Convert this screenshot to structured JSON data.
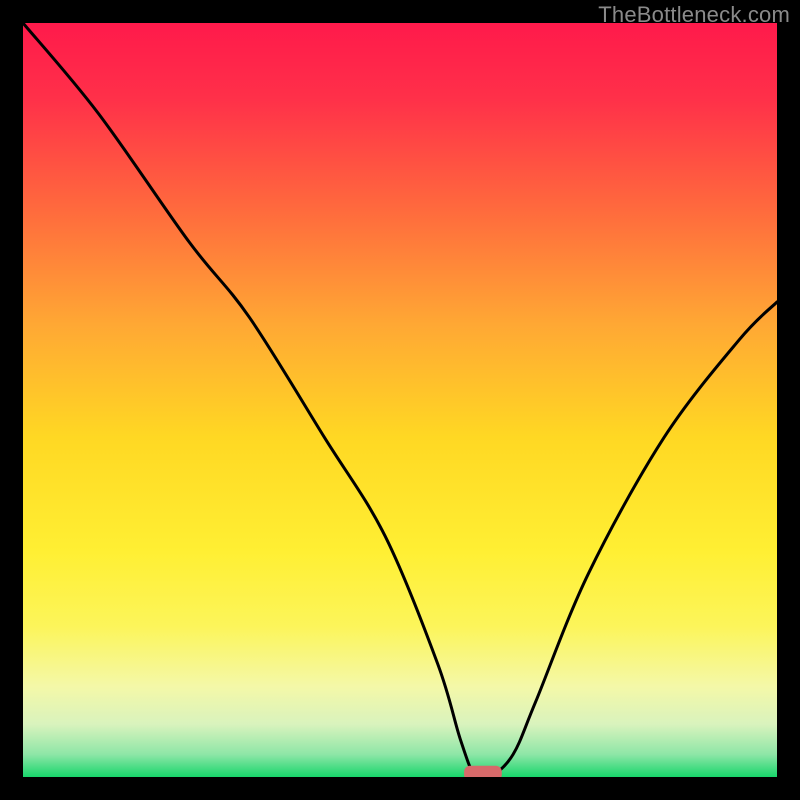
{
  "watermark": "TheBottleneck.com",
  "chart_data": {
    "type": "line",
    "title": "",
    "xlabel": "",
    "ylabel": "",
    "xlim": [
      0,
      100
    ],
    "ylim": [
      0,
      100
    ],
    "grid": false,
    "legend": false,
    "gradient_stops": [
      {
        "offset": 0.0,
        "color": "#ff1a4b"
      },
      {
        "offset": 0.1,
        "color": "#ff3049"
      },
      {
        "offset": 0.25,
        "color": "#ff6b3d"
      },
      {
        "offset": 0.4,
        "color": "#ffa834"
      },
      {
        "offset": 0.55,
        "color": "#ffd823"
      },
      {
        "offset": 0.7,
        "color": "#ffef33"
      },
      {
        "offset": 0.8,
        "color": "#fcf55a"
      },
      {
        "offset": 0.88,
        "color": "#f4f8a8"
      },
      {
        "offset": 0.93,
        "color": "#d9f3bd"
      },
      {
        "offset": 0.97,
        "color": "#8ee6a7"
      },
      {
        "offset": 1.0,
        "color": "#18d66b"
      }
    ],
    "series": [
      {
        "name": "bottleneck-curve",
        "color": "#000000",
        "x": [
          0,
          10,
          22,
          30,
          40,
          48,
          55,
          58,
          60,
          62,
          65,
          68,
          75,
          85,
          95,
          100
        ],
        "y": [
          100,
          88,
          71,
          61,
          45,
          32,
          15,
          5,
          0,
          0,
          3,
          10,
          27,
          45,
          58,
          63
        ]
      }
    ],
    "marker": {
      "name": "optimal-point",
      "x": 61,
      "y": 0.5,
      "width": 5,
      "height": 2,
      "color": "#d76a6a"
    }
  }
}
